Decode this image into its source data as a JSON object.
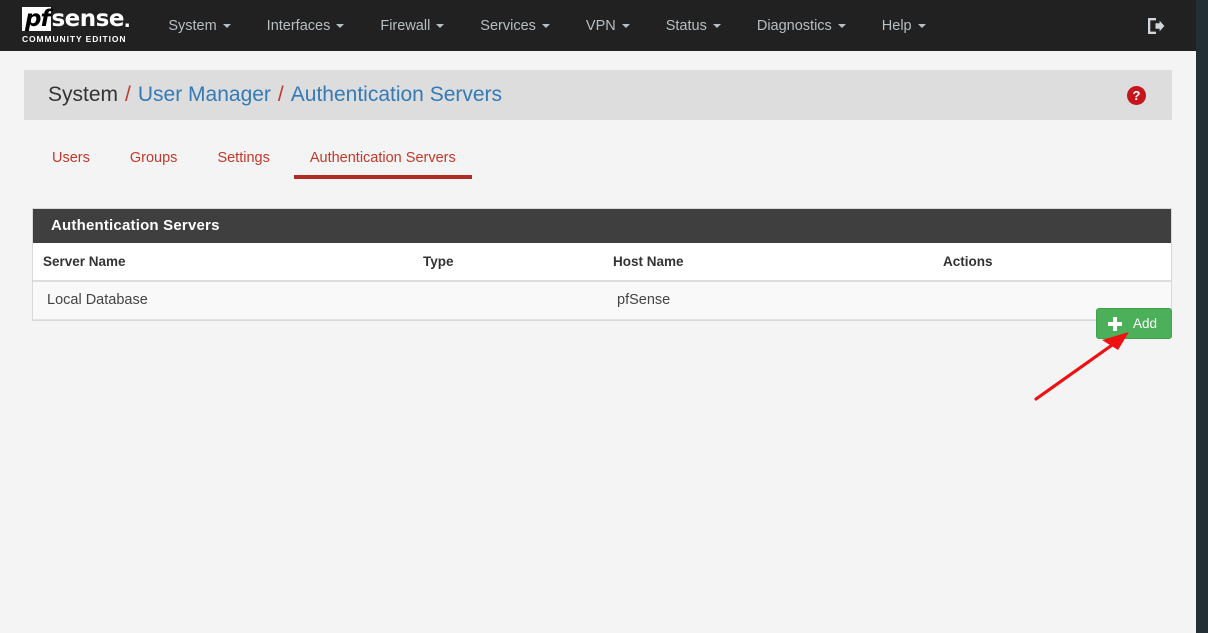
{
  "brand": {
    "name_prefix": "pf",
    "name_suffix": "sense",
    "dot": ".",
    "subtitle": "COMMUNITY EDITION"
  },
  "navbar": {
    "items": [
      {
        "label": "System",
        "has_caret": true
      },
      {
        "label": "Interfaces",
        "has_caret": true
      },
      {
        "label": "Firewall",
        "has_caret": true
      },
      {
        "label": "Services",
        "has_caret": true
      },
      {
        "label": "VPN",
        "has_caret": true
      },
      {
        "label": "Status",
        "has_caret": true
      },
      {
        "label": "Diagnostics",
        "has_caret": true
      },
      {
        "label": "Help",
        "has_caret": true
      }
    ],
    "logout_icon": "logout-icon",
    "background": "#212121",
    "text_color": "#b6bfc4"
  },
  "breadcrumb": {
    "root": "System",
    "separator": "/",
    "links": [
      "User Manager",
      "Authentication Servers"
    ],
    "help_icon": "help-circle-icon",
    "link_color": "#337ab7",
    "separator_color": "#c0392b"
  },
  "tabs": {
    "items": [
      {
        "label": "Users",
        "active": false
      },
      {
        "label": "Groups",
        "active": false
      },
      {
        "label": "Settings",
        "active": false
      },
      {
        "label": "Authentication Servers",
        "active": true
      }
    ],
    "color": "#c0392b",
    "active_underline": "#b02b24"
  },
  "panel": {
    "title": "Authentication Servers",
    "header_background": "#3f3f3f",
    "columns": [
      "Server Name",
      "Type",
      "Host Name",
      "Actions"
    ],
    "rows": [
      {
        "server_name": "Local Database",
        "type": "",
        "host_name": "pfSense",
        "actions": ""
      }
    ]
  },
  "toolbar": {
    "add_label": "Add",
    "add_icon": "plus-icon",
    "add_color": "#4caf5a"
  },
  "annotation": {
    "arrow_icon": "red-arrow-icon",
    "arrow_color": "#ee1111"
  }
}
